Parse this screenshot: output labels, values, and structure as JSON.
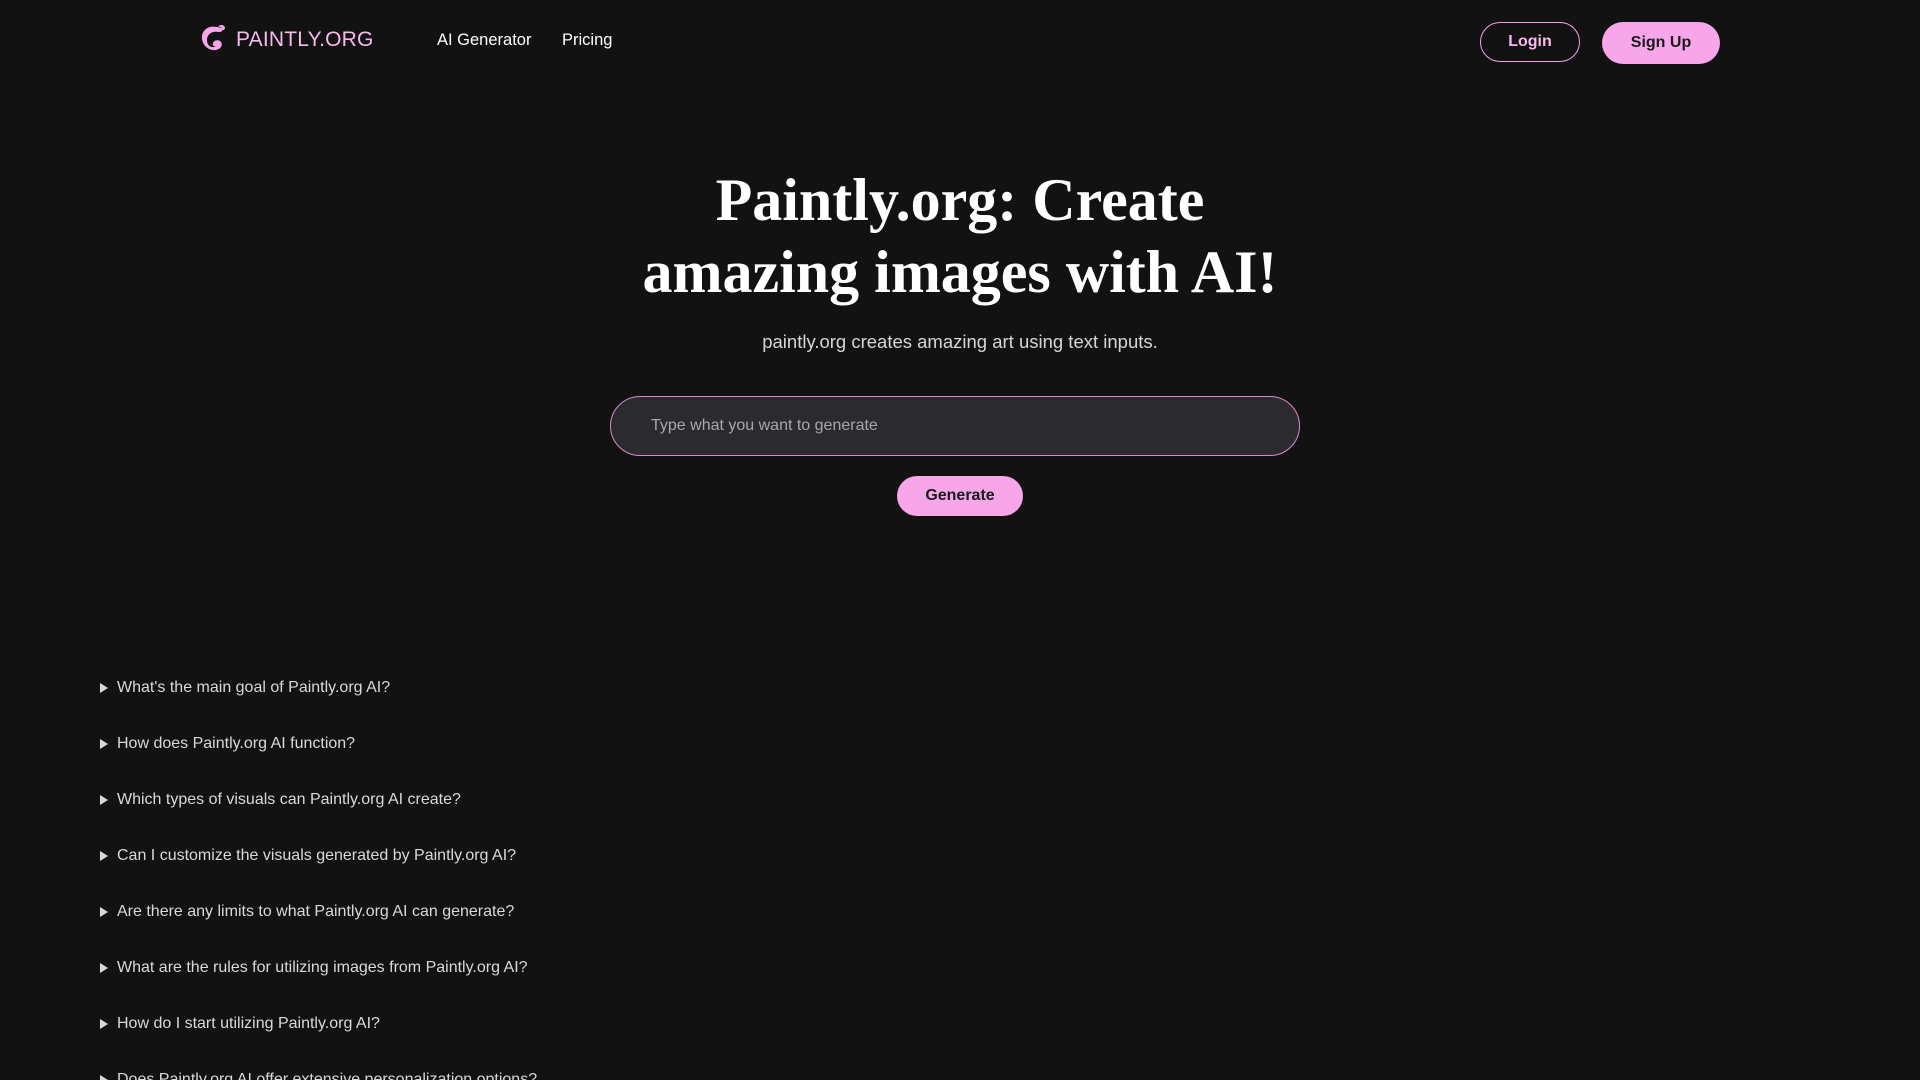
{
  "header": {
    "logo_text": "PAINTLY.ORG",
    "nav": [
      {
        "label": "AI Generator"
      },
      {
        "label": "Pricing"
      }
    ],
    "login_label": "Login",
    "signup_label": "Sign Up"
  },
  "hero": {
    "title_line1": "Paintly.org: Create",
    "title_line2": "amazing images with AI!",
    "subtitle": "paintly.org creates amazing art using text inputs.",
    "input_placeholder": "Type what you want to generate",
    "generate_label": "Generate"
  },
  "faq": {
    "items": [
      {
        "question": "What's the main goal of Paintly.org AI?"
      },
      {
        "question": "How does Paintly.org AI function?"
      },
      {
        "question": "Which types of visuals can Paintly.org AI create?"
      },
      {
        "question": "Can I customize the visuals generated by Paintly.org AI?"
      },
      {
        "question": "Are there any limits to what Paintly.org AI can generate?"
      },
      {
        "question": "What are the rules for utilizing images from Paintly.org AI?"
      },
      {
        "question": "How do I start utilizing Paintly.org AI?"
      },
      {
        "question": "Does Paintly.org AI offer extensive personalization options?"
      }
    ]
  },
  "colors": {
    "background": "#121212",
    "accent_pink": "#f7a6ea",
    "input_bg": "#2b2a2f"
  },
  "icons": {
    "logo": "paintbrush-swirl-icon",
    "faq_marker": "triangle-right-icon"
  }
}
